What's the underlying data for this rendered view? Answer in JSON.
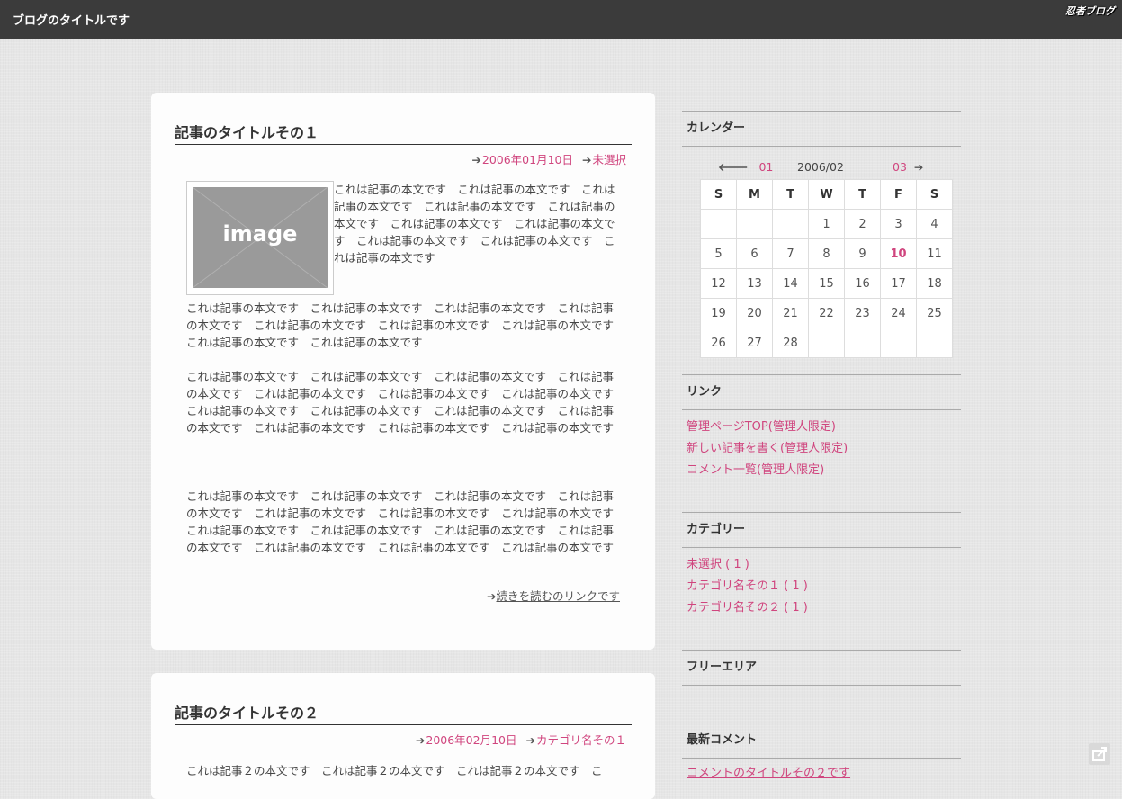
{
  "header": {
    "blog_title": "ブログのタイトルです",
    "logo": "忍者ブログ"
  },
  "articles": [
    {
      "title": "記事のタイトルその１",
      "date": "2006年01月10日",
      "category": "未選択",
      "image_label": "image",
      "float_text": "これは記事の本文です　これは記事の本文です　これは記事の本文です　これは記事の本文です　これは記事の本文です　これは記事の本文です　これは記事の本文です　これは記事の本文です　これは記事の本文です　これは記事の本文です",
      "paragraphs": [
        "これは記事の本文です　これは記事の本文です　これは記事の本文です　これは記事の本文です　これは記事の本文です　これは記事の本文です　これは記事の本文です　これは記事の本文です　これは記事の本文です",
        "これは記事の本文です　これは記事の本文です　これは記事の本文です　これは記事の本文です　これは記事の本文です　これは記事の本文です　これは記事の本文です　これは記事の本文です　これは記事の本文です　これは記事の本文です　これは記事の本文です　これは記事の本文です　これは記事の本文です　これは記事の本文です",
        "これは記事の本文です　これは記事の本文です　これは記事の本文です　これは記事の本文です　これは記事の本文です　これは記事の本文です　これは記事の本文です　これは記事の本文です　これは記事の本文です　これは記事の本文です　これは記事の本文です　これは記事の本文です　これは記事の本文です　これは記事の本文です"
      ],
      "read_more": "続きを読むのリンクです"
    },
    {
      "title": "記事のタイトルその２",
      "date": "2006年02月10日",
      "category": "カテゴリ名その１",
      "paragraph": "これは記事２の本文です　これは記事２の本文です　これは記事２の本文です　こ"
    }
  ],
  "sidebar": {
    "calendar": {
      "heading": "カレンダー",
      "prev": "01",
      "current": "2006/02",
      "next": "03",
      "weekdays": [
        "S",
        "M",
        "T",
        "W",
        "T",
        "F",
        "S"
      ],
      "weeks": [
        [
          "",
          "",
          "",
          "1",
          "2",
          "3",
          "4"
        ],
        [
          "5",
          "6",
          "7",
          "8",
          "9",
          "10",
          "11"
        ],
        [
          "12",
          "13",
          "14",
          "15",
          "16",
          "17",
          "18"
        ],
        [
          "19",
          "20",
          "21",
          "22",
          "23",
          "24",
          "25"
        ],
        [
          "26",
          "27",
          "28",
          "",
          "",
          "",
          ""
        ]
      ],
      "today": "10"
    },
    "links": {
      "heading": "リンク",
      "items": [
        "管理ページTOP(管理人限定)",
        "新しい記事を書く(管理人限定)",
        "コメント一覧(管理人限定)"
      ]
    },
    "categories": {
      "heading": "カテゴリー",
      "items": [
        "未選択 ( 1 )",
        "カテゴリ名その１ ( 1 )",
        "カテゴリ名その２ ( 1 )"
      ]
    },
    "free_area": {
      "heading": "フリーエリア"
    },
    "recent_comments": {
      "heading": "最新コメント",
      "items": [
        "コメントのタイトルその２です"
      ]
    }
  },
  "colors": {
    "link": "#d0457e",
    "header_bg": "#3b3b3b"
  }
}
